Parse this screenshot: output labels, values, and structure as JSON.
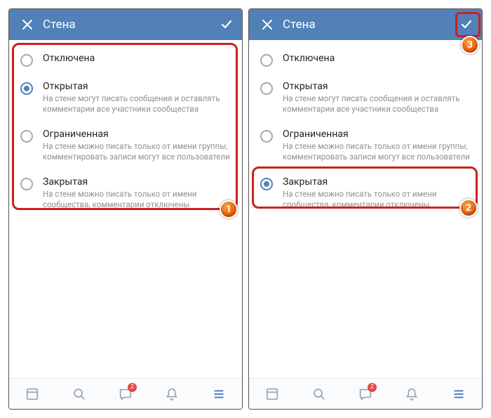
{
  "header": {
    "title": "Стена"
  },
  "options": [
    {
      "title": "Отключена",
      "desc": ""
    },
    {
      "title": "Открытая",
      "desc": "На стене могут писать сообщения и оставлять комментарии все участники сообщества"
    },
    {
      "title": "Ограниченная",
      "desc": "На стене можно писать только от имени группы, комментировать записи могут все пользователи"
    },
    {
      "title": "Закрытая",
      "desc": "На стене можно писать только от имени сообщества, комментарии отключены"
    }
  ],
  "panels": [
    {
      "selected": 1
    },
    {
      "selected": 3
    }
  ],
  "nav": {
    "messages_badge": "2"
  },
  "markers": {
    "m1": "1",
    "m2": "2",
    "m3": "3"
  }
}
